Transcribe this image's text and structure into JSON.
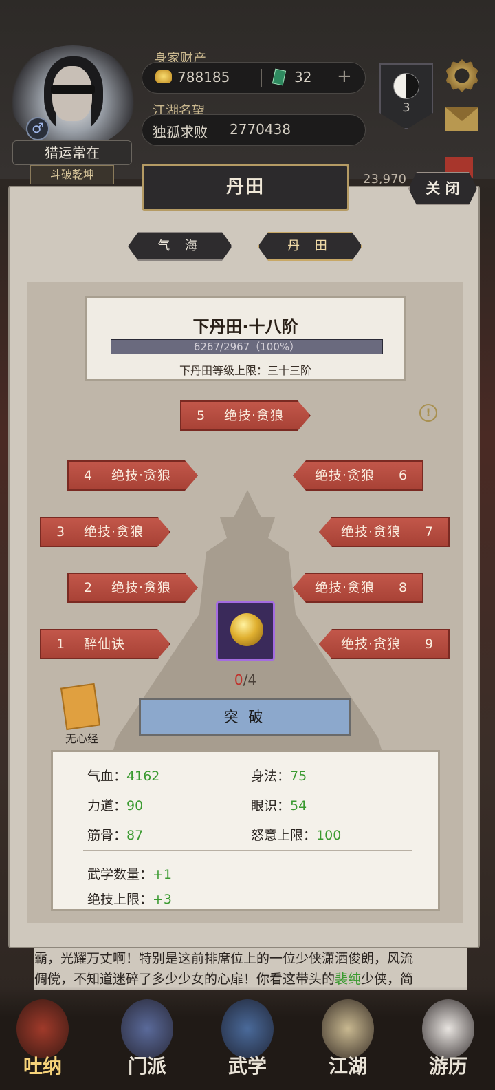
{
  "header": {
    "wealth_label": "身家财产",
    "gold": "788185",
    "jade": "32",
    "reputation_label": "江湖名望",
    "rep_title": "独孤求败",
    "rep_value": "2770438",
    "player_name": "猎运常在",
    "player_title": "斗破乾坤",
    "rank_level": "3",
    "power_value": "23,970"
  },
  "panel": {
    "title": "丹田",
    "close_label": "关 闭",
    "tabs": [
      "气 海",
      "丹 田"
    ],
    "active_tab": 1,
    "stage_title": "下丹田·十八阶",
    "progress_text": "6267/2967（100%）",
    "progress_fraction": 1.0,
    "limit_text": "下丹田等级上限：三十三阶",
    "slots": [
      {
        "num": "1",
        "name": "醉仙诀"
      },
      {
        "num": "2",
        "name": "绝技·贪狼"
      },
      {
        "num": "3",
        "name": "绝技·贪狼"
      },
      {
        "num": "4",
        "name": "绝技·贪狼"
      },
      {
        "num": "5",
        "name": "绝技·贪狼"
      },
      {
        "num": "6",
        "name": "绝技·贪狼"
      },
      {
        "num": "7",
        "name": "绝技·贪狼"
      },
      {
        "num": "8",
        "name": "绝技·贪狼"
      },
      {
        "num": "9",
        "name": "绝技·贪狼"
      }
    ],
    "item_count_have": "0",
    "item_count_need": "/4",
    "book_label": "无心经",
    "breakthrough_label": "突 破",
    "stats": {
      "hp_label": "气血：",
      "hp": "4162",
      "agility_label": "身法：",
      "agility": "75",
      "strength_label": "力道：",
      "strength": "90",
      "insight_label": "眼识：",
      "insight": "54",
      "bone_label": "筋骨：",
      "bone": "87",
      "rage_label": "怒意上限：",
      "rage": "100",
      "martial_label": "武学数量：",
      "martial": "+1",
      "skill_label": "绝技上限：",
      "skill": "+3"
    }
  },
  "story": {
    "line1": "霸，光耀万丈啊！特别是这前排席位上的一位少侠潇洒俊朗，风流",
    "line2_a": "倜傥，不知道迷碎了多少少女的心扉！你看这带头的",
    "line2_hl": "裴纯",
    "line2_b": "少侠，简"
  },
  "nav": [
    "吐纳",
    "门派",
    "武学",
    "江湖",
    "游历"
  ]
}
